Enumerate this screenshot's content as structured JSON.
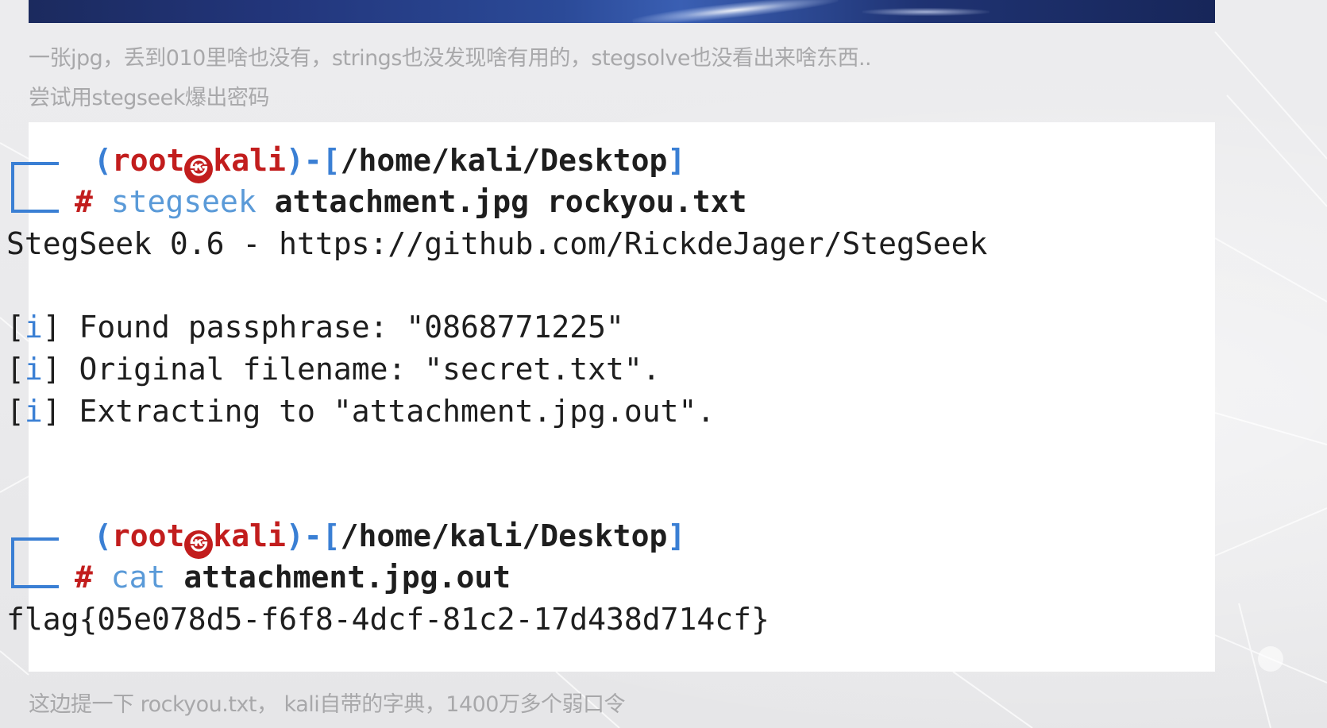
{
  "paragraphs": {
    "p1": "一张jpg，丢到010里啥也没有，strings也没发现啥有用的，stegsolve也没看出来啥东西..",
    "p2": "尝试用stegseek爆出密码",
    "p3": "这边提一下 rockyou.txt， kali自带的字典，1400万多个弱口令"
  },
  "terminal": {
    "prompt1": {
      "open": "(",
      "user": "root",
      "host": "kali",
      "sep": ")-[",
      "path": "/home/kali/Desktop",
      "close": "]",
      "hash": "#",
      "cmd": "stegseek",
      "args": "attachment.jpg rockyou.txt"
    },
    "out1": "StegSeek 0.6 - https://github.com/RickdeJager/StegSeek",
    "info": [
      {
        "bracket_open": "[",
        "i": "i",
        "bracket_close": "]",
        "text": " Found passphrase: \"0868771225\""
      },
      {
        "bracket_open": "[",
        "i": "i",
        "bracket_close": "]",
        "text": " Original filename: \"secret.txt\"."
      },
      {
        "bracket_open": "[",
        "i": "i",
        "bracket_close": "]",
        "text": " Extracting to \"attachment.jpg.out\"."
      }
    ],
    "prompt2": {
      "open": "(",
      "user": "root",
      "host": "kali",
      "sep": ")-[",
      "path": "/home/kali/Desktop",
      "close": "]",
      "hash": "#",
      "cmd": "cat",
      "args": "attachment.jpg.out"
    },
    "flag": "flag{05e078d5-f6f8-4dcf-81c2-17d438d714cf}"
  },
  "icons": {
    "kali_at": "kali-dragon-icon"
  },
  "colors": {
    "prompt_blue": "#3a7fd4",
    "prompt_red": "#c21d1d",
    "paragraph_gray": "#a8a8aa"
  }
}
